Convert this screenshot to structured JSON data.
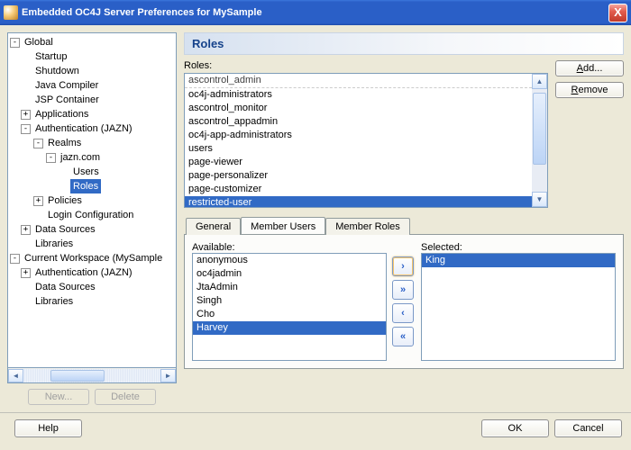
{
  "window": {
    "title": "Embedded OC4J Server Preferences for MySample",
    "close_glyph": "X"
  },
  "tree": {
    "nodes": [
      {
        "indent": 0,
        "exp": "-",
        "label": "Global"
      },
      {
        "indent": 1,
        "exp": "",
        "label": "Startup"
      },
      {
        "indent": 1,
        "exp": "",
        "label": "Shutdown"
      },
      {
        "indent": 1,
        "exp": "",
        "label": "Java Compiler"
      },
      {
        "indent": 1,
        "exp": "",
        "label": "JSP Container"
      },
      {
        "indent": 1,
        "exp": "+",
        "label": "Applications"
      },
      {
        "indent": 1,
        "exp": "-",
        "label": "Authentication (JAZN)"
      },
      {
        "indent": 2,
        "exp": "-",
        "label": "Realms"
      },
      {
        "indent": 3,
        "exp": "-",
        "label": "jazn.com"
      },
      {
        "indent": 4,
        "exp": "",
        "label": "Users"
      },
      {
        "indent": 4,
        "exp": "",
        "label": "Roles",
        "selected": true
      },
      {
        "indent": 2,
        "exp": "+",
        "label": "Policies"
      },
      {
        "indent": 2,
        "exp": "",
        "label": "Login Configuration"
      },
      {
        "indent": 1,
        "exp": "+",
        "label": "Data Sources"
      },
      {
        "indent": 1,
        "exp": "",
        "label": "Libraries"
      },
      {
        "indent": 0,
        "exp": "-",
        "label": "Current Workspace (MySample"
      },
      {
        "indent": 1,
        "exp": "+",
        "label": "Authentication (JAZN)"
      },
      {
        "indent": 1,
        "exp": "",
        "label": "Data Sources"
      },
      {
        "indent": 1,
        "exp": "",
        "label": "Libraries"
      }
    ],
    "buttons": {
      "new": "New...",
      "delete": "Delete"
    }
  },
  "roles_section": {
    "heading": "Roles",
    "label": "Roles:",
    "items": [
      {
        "text": "ascontrol_admin",
        "cut": true
      },
      {
        "text": "oc4j-administrators"
      },
      {
        "text": "ascontrol_monitor"
      },
      {
        "text": "ascontrol_appadmin"
      },
      {
        "text": "oc4j-app-administrators"
      },
      {
        "text": "users"
      },
      {
        "text": "page-viewer"
      },
      {
        "text": "page-personalizer"
      },
      {
        "text": "page-customizer"
      },
      {
        "text": "restricted-user",
        "selected": true
      }
    ],
    "buttons": {
      "add": "Add...",
      "remove": "Remove"
    }
  },
  "tabs": {
    "general": "General",
    "member_users": "Member Users",
    "member_roles": "Member Roles",
    "active": "member_users"
  },
  "shuttle": {
    "available_label": "Available:",
    "selected_label": "Selected:",
    "available": [
      {
        "text": "anonymous"
      },
      {
        "text": "oc4jadmin"
      },
      {
        "text": "JtaAdmin"
      },
      {
        "text": "Singh"
      },
      {
        "text": "Cho"
      },
      {
        "text": "Harvey",
        "selected": true
      }
    ],
    "selected": [
      {
        "text": "King",
        "selected": true
      }
    ],
    "glyphs": {
      "right": "›",
      "all_right": "»",
      "left": "‹",
      "all_left": "«"
    }
  },
  "footer": {
    "help": "Help",
    "ok": "OK",
    "cancel": "Cancel"
  },
  "scroll_glyphs": {
    "left": "◄",
    "right": "►",
    "up": "▲",
    "down": "▼"
  }
}
